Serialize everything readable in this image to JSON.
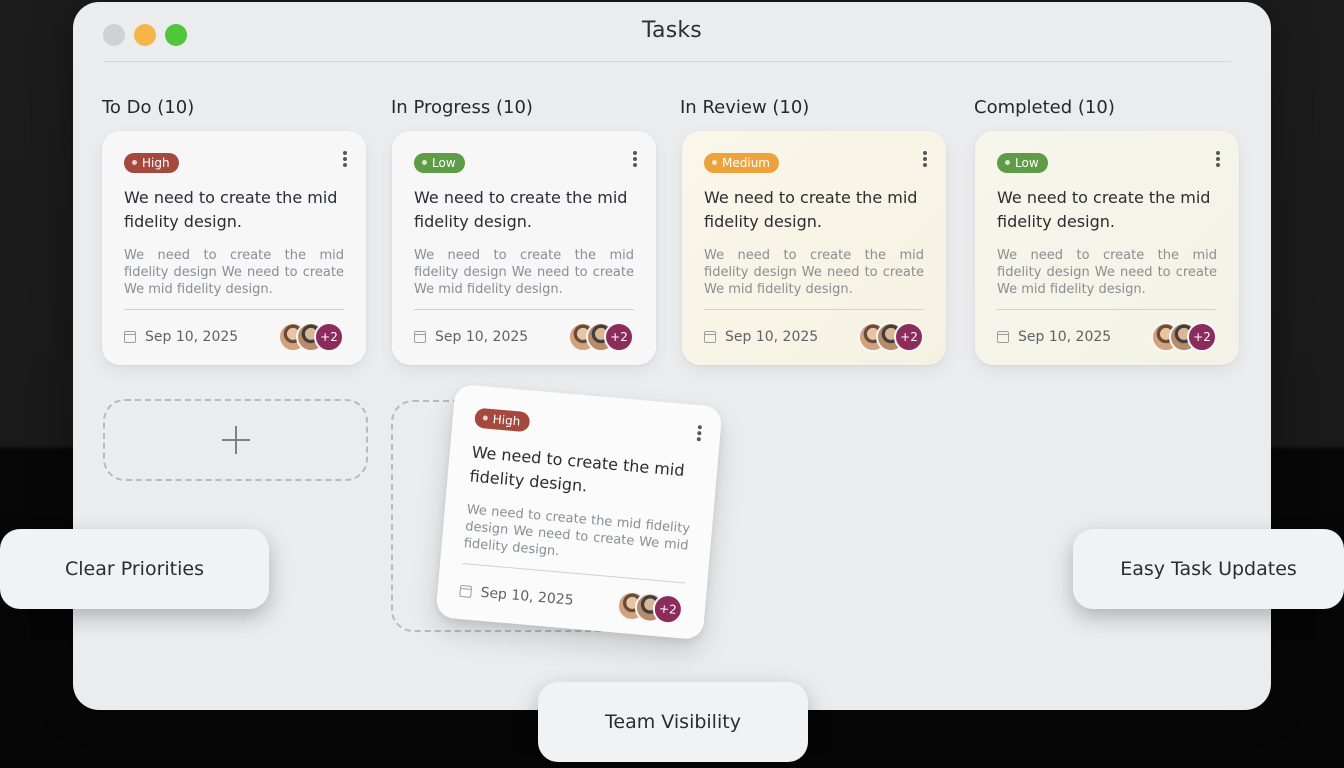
{
  "window": {
    "title": "Tasks"
  },
  "columns": [
    {
      "label": "To Do (10)",
      "card": {
        "priority": "High",
        "title": "We need to create the mid fidelity design.",
        "description": "We need to create the mid fidelity design We need to create We mid fidelity design.",
        "date": "Sep 10, 2025",
        "more_count": "+2"
      }
    },
    {
      "label": "In Progress (10)",
      "card": {
        "priority": "Low",
        "title": "We need to create the mid fidelity design.",
        "description": "We need to create the mid fidelity design We need to create We mid fidelity design.",
        "date": "Sep 10, 2025",
        "more_count": "+2"
      }
    },
    {
      "label": "In Review (10)",
      "card": {
        "priority": "Medium",
        "title": "We need to create the mid fidelity design.",
        "description": "We need to create the mid fidelity design We need to create We mid fidelity design.",
        "date": "Sep 10, 2025",
        "more_count": "+2"
      }
    },
    {
      "label": "Completed (10)",
      "card": {
        "priority": "Low",
        "title": "We need to create the mid fidelity design.",
        "description": "We need to create the mid fidelity design We need to create We mid fidelity design.",
        "date": "Sep 10, 2025",
        "more_count": "+2"
      }
    }
  ],
  "dragging_card": {
    "priority": "High",
    "title": "We need to create the mid fidelity design.",
    "description": "We need to create the mid fidelity design We need to create We mid fidelity design.",
    "date": "Sep 10, 2025",
    "more_count": "+2"
  },
  "add_slot": {
    "icon": "plus-icon"
  },
  "features": {
    "left": "Clear Priorities",
    "right": "Easy Task Updates",
    "bottom": "Team Visibility"
  },
  "colors": {
    "priority_high": "#a5493f",
    "priority_low": "#5e9c45",
    "priority_medium": "#eda23a",
    "avatar_more": "#8b2c5d"
  }
}
